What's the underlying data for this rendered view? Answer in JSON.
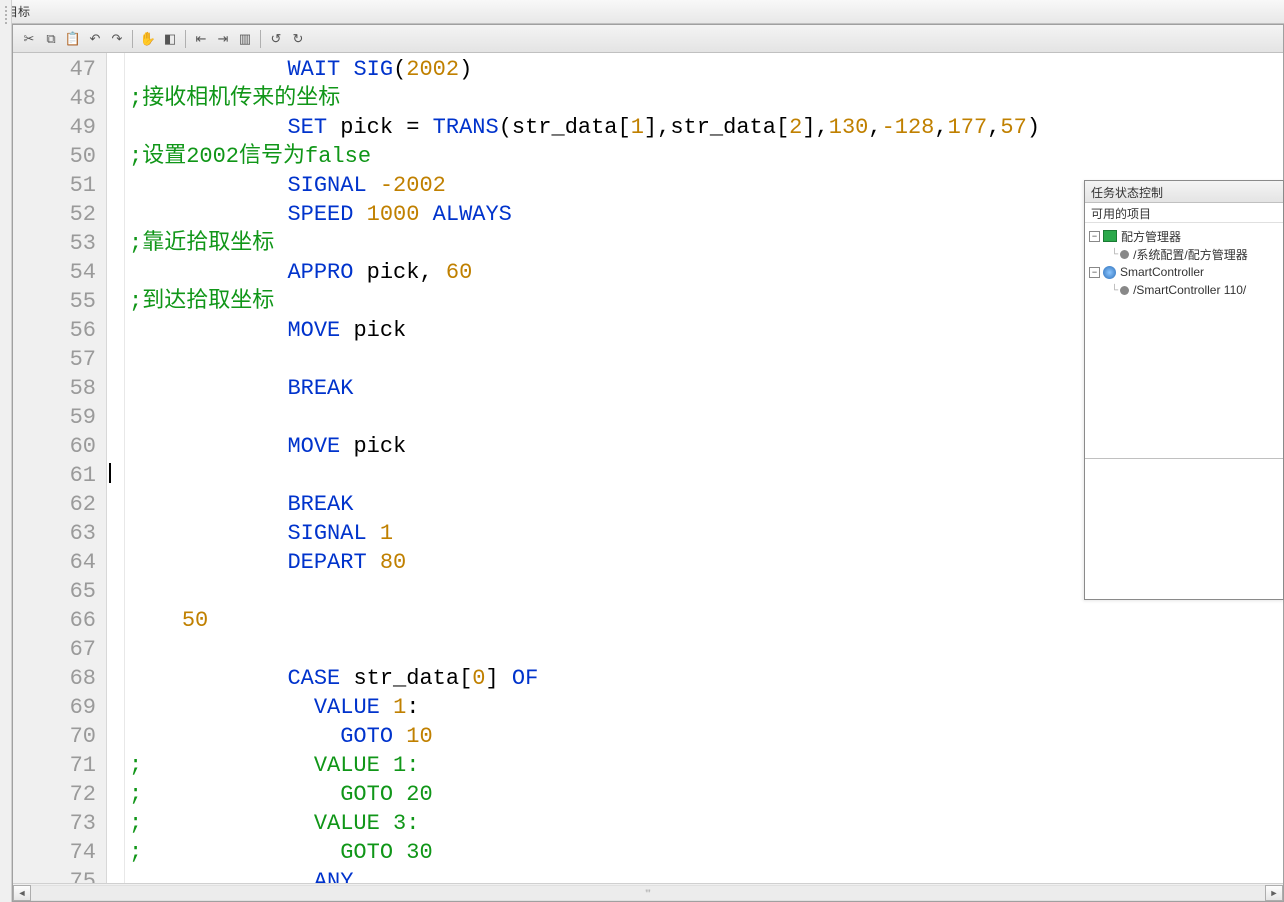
{
  "topbar": {
    "label": "目标"
  },
  "toolbar_icons": [
    "cut",
    "copy",
    "paste",
    "undo",
    "redo",
    "hand",
    "eraser",
    "indent",
    "outdent",
    "block",
    "undo2",
    "redo2"
  ],
  "gutter": {
    "start": 47,
    "end": 75
  },
  "code": {
    "l47": {
      "seg": [
        {
          "t": "            ",
          "c": ""
        },
        {
          "t": "WAIT SIG",
          "c": "kw"
        },
        {
          "t": "(",
          "c": ""
        },
        {
          "t": "2002",
          "c": "num"
        },
        {
          "t": ")",
          "c": ""
        }
      ]
    },
    "l48": {
      "seg": [
        {
          "t": ";接收相机传来的坐标",
          "c": "cmnt"
        }
      ]
    },
    "l49": {
      "seg": [
        {
          "t": "            ",
          "c": ""
        },
        {
          "t": "SET",
          "c": "kw"
        },
        {
          "t": " pick = ",
          "c": ""
        },
        {
          "t": "TRANS",
          "c": "kw"
        },
        {
          "t": "(str_data[",
          "c": ""
        },
        {
          "t": "1",
          "c": "num"
        },
        {
          "t": "],str_data[",
          "c": ""
        },
        {
          "t": "2",
          "c": "num"
        },
        {
          "t": "],",
          "c": ""
        },
        {
          "t": "130",
          "c": "num"
        },
        {
          "t": ",",
          "c": ""
        },
        {
          "t": "-128",
          "c": "num"
        },
        {
          "t": ",",
          "c": ""
        },
        {
          "t": "177",
          "c": "num"
        },
        {
          "t": ",",
          "c": ""
        },
        {
          "t": "57",
          "c": "num"
        },
        {
          "t": ")",
          "c": ""
        }
      ]
    },
    "l50": {
      "seg": [
        {
          "t": ";设置2002信号为false",
          "c": "cmnt"
        }
      ]
    },
    "l51": {
      "seg": [
        {
          "t": "            ",
          "c": ""
        },
        {
          "t": "SIGNAL",
          "c": "kw"
        },
        {
          "t": " ",
          "c": ""
        },
        {
          "t": "-2002",
          "c": "num"
        }
      ]
    },
    "l52": {
      "seg": [
        {
          "t": "            ",
          "c": ""
        },
        {
          "t": "SPEED",
          "c": "kw"
        },
        {
          "t": " ",
          "c": ""
        },
        {
          "t": "1000",
          "c": "num"
        },
        {
          "t": " ",
          "c": ""
        },
        {
          "t": "ALWAYS",
          "c": "kw"
        }
      ]
    },
    "l53": {
      "seg": [
        {
          "t": ";靠近拾取坐标",
          "c": "cmnt"
        }
      ]
    },
    "l54": {
      "seg": [
        {
          "t": "            ",
          "c": ""
        },
        {
          "t": "APPRO",
          "c": "kw"
        },
        {
          "t": " pick, ",
          "c": ""
        },
        {
          "t": "60",
          "c": "num"
        }
      ]
    },
    "l55": {
      "seg": [
        {
          "t": ";到达拾取坐标",
          "c": "cmnt"
        }
      ]
    },
    "l56": {
      "seg": [
        {
          "t": "            ",
          "c": ""
        },
        {
          "t": "MOVE",
          "c": "kw"
        },
        {
          "t": " pick",
          "c": ""
        }
      ]
    },
    "l57": {
      "seg": [
        {
          "t": "",
          "c": ""
        }
      ]
    },
    "l58": {
      "seg": [
        {
          "t": "            ",
          "c": ""
        },
        {
          "t": "BREAK",
          "c": "kw"
        }
      ]
    },
    "l59": {
      "seg": [
        {
          "t": "",
          "c": ""
        }
      ]
    },
    "l60": {
      "seg": [
        {
          "t": "            ",
          "c": ""
        },
        {
          "t": "MOVE",
          "c": "kw"
        },
        {
          "t": " pick",
          "c": ""
        }
      ]
    },
    "l61": {
      "seg": [
        {
          "t": "",
          "c": ""
        }
      ]
    },
    "l62": {
      "seg": [
        {
          "t": "            ",
          "c": ""
        },
        {
          "t": "BREAK",
          "c": "kw"
        }
      ]
    },
    "l63": {
      "seg": [
        {
          "t": "            ",
          "c": ""
        },
        {
          "t": "SIGNAL",
          "c": "kw"
        },
        {
          "t": " ",
          "c": ""
        },
        {
          "t": "1",
          "c": "num"
        }
      ]
    },
    "l64": {
      "seg": [
        {
          "t": "            ",
          "c": ""
        },
        {
          "t": "DEPART",
          "c": "kw"
        },
        {
          "t": " ",
          "c": ""
        },
        {
          "t": "80",
          "c": "num"
        }
      ]
    },
    "l65": {
      "seg": [
        {
          "t": "",
          "c": ""
        }
      ]
    },
    "l66": {
      "seg": [
        {
          "t": "    ",
          "c": ""
        },
        {
          "t": "50",
          "c": "num"
        }
      ]
    },
    "l67": {
      "seg": [
        {
          "t": "",
          "c": ""
        }
      ]
    },
    "l68": {
      "seg": [
        {
          "t": "            ",
          "c": ""
        },
        {
          "t": "CASE",
          "c": "kw"
        },
        {
          "t": " str_data[",
          "c": ""
        },
        {
          "t": "0",
          "c": "num"
        },
        {
          "t": "] ",
          "c": ""
        },
        {
          "t": "OF",
          "c": "kw"
        }
      ]
    },
    "l69": {
      "seg": [
        {
          "t": "              ",
          "c": ""
        },
        {
          "t": "VALUE",
          "c": "kw"
        },
        {
          "t": " ",
          "c": ""
        },
        {
          "t": "1",
          "c": "num"
        },
        {
          "t": ":",
          "c": ""
        }
      ]
    },
    "l70": {
      "seg": [
        {
          "t": "                ",
          "c": ""
        },
        {
          "t": "GOTO",
          "c": "kw"
        },
        {
          "t": " ",
          "c": ""
        },
        {
          "t": "10",
          "c": "num"
        }
      ]
    },
    "l71": {
      "seg": [
        {
          "t": ";             VALUE 1:",
          "c": "cmnt"
        }
      ]
    },
    "l72": {
      "seg": [
        {
          "t": ";               GOTO 20",
          "c": "cmnt"
        }
      ]
    },
    "l73": {
      "seg": [
        {
          "t": ";             VALUE 3:",
          "c": "cmnt"
        }
      ]
    },
    "l74": {
      "seg": [
        {
          "t": ";               GOTO 30",
          "c": "cmnt"
        }
      ]
    },
    "l75": {
      "seg": [
        {
          "t": "              ",
          "c": ""
        },
        {
          "t": "ANY",
          "c": "kw"
        }
      ]
    }
  },
  "side_panel": {
    "title": "任务状态控制",
    "sub": "可用的项目",
    "tree": {
      "recipe_mgr": "配方管理器",
      "recipe_path": "/系统配置/配方管理器",
      "controller": "SmartController",
      "controller_path": "/SmartController 110/"
    }
  },
  "scroll": {
    "left": "◄",
    "right": "►",
    "thumb": "ꞌꞌꞌ"
  }
}
